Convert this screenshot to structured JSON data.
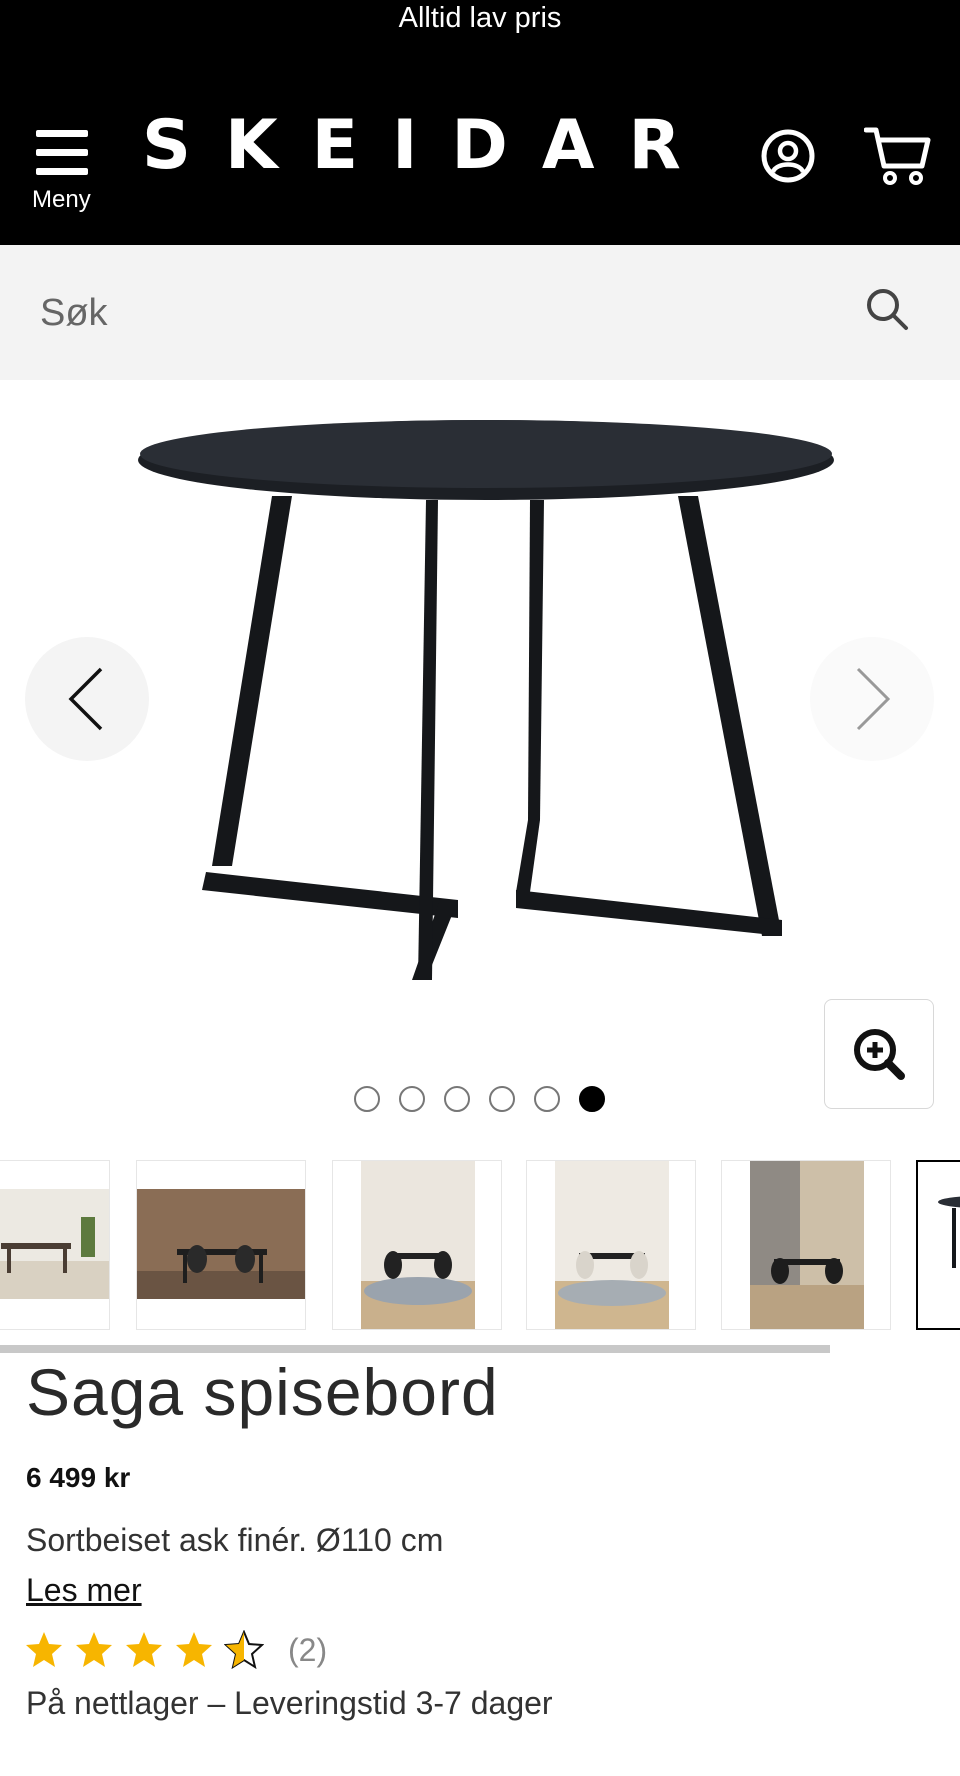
{
  "banner": {
    "text": "Alltid lav pris"
  },
  "header": {
    "menu_label": "Meny",
    "logo": "SKEIDAR"
  },
  "search": {
    "placeholder": "Søk"
  },
  "gallery": {
    "dot_count": 6,
    "active_dot": 6,
    "thumbnails": [
      {
        "desc": "dining room scene"
      },
      {
        "desc": "dining room scene dark"
      },
      {
        "desc": "dining room scene with rug"
      },
      {
        "desc": "dining room scene light"
      },
      {
        "desc": "dining room scene beige"
      },
      {
        "desc": "table product"
      }
    ]
  },
  "product": {
    "title": "Saga spisebord",
    "price": "6 499 kr",
    "description": "Sortbeiset ask finér. Ø110 cm",
    "read_more": "Les mer",
    "rating": 4.5,
    "review_count": "(2)",
    "stock": "På nettlager – Leveringstid 3-7 dager"
  },
  "colors": {
    "header_bg": "#000000",
    "search_bg": "#f3f3f3",
    "star": "#f7b500"
  }
}
